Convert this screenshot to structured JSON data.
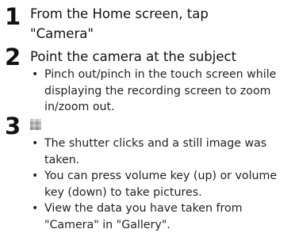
{
  "steps": [
    {
      "number": "1",
      "title_line1": "From the Home screen, tap",
      "title_line2": "\"Camera\""
    },
    {
      "number": "2",
      "title": "Point the camera at the subject",
      "bullets": [
        {
          "lines": [
            "Pinch out/pinch in the touch screen while",
            "displaying the recording screen to zoom",
            "in/zoom out."
          ]
        }
      ]
    },
    {
      "number": "3",
      "icon": "shutter-key-icon",
      "bullets": [
        {
          "lines": [
            "The shutter clicks and a still image was",
            "taken."
          ]
        },
        {
          "lines": [
            "You can press volume key (up) or volume",
            "key (down) to take pictures."
          ]
        },
        {
          "lines": [
            "View the data you have taken from",
            "\"Camera\" in \"Gallery\"."
          ]
        }
      ]
    }
  ],
  "bullet_symbol": "•"
}
